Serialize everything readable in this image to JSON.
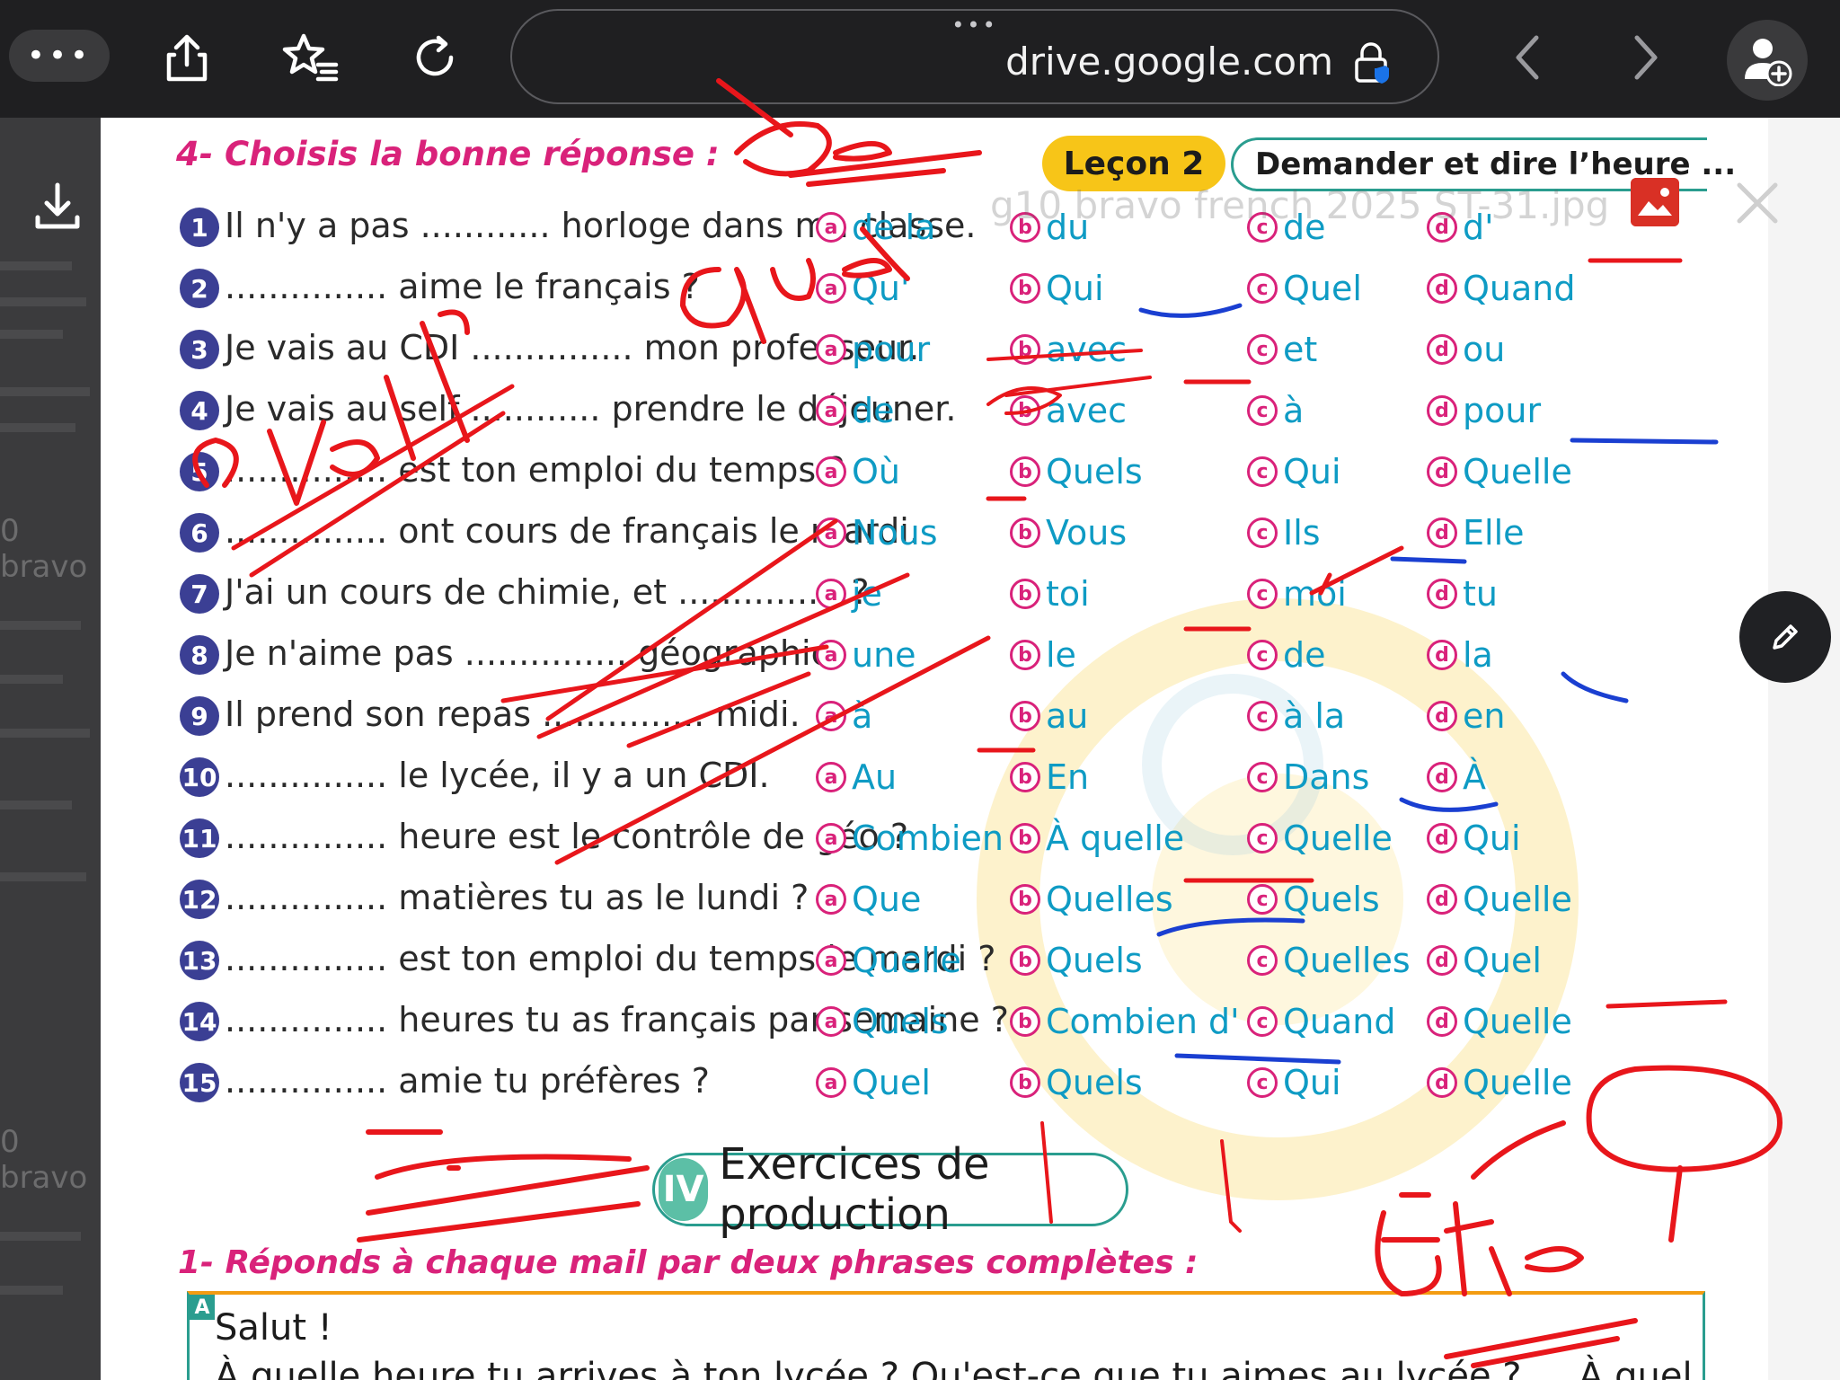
{
  "browser": {
    "address": "drive.google.com",
    "grip": "•••",
    "more_label": "•••",
    "icons": {
      "share": "share-icon",
      "bookmarks": "bookmarks-icon",
      "reload": "reload-icon",
      "lock": "lock-icon",
      "back": "chevron-left-icon",
      "forward": "chevron-right-icon",
      "profile": "add-person-icon"
    }
  },
  "viewer": {
    "filename": "g10 bravo french 2025 ST-31.jpg",
    "background_peek": [
      "0 bravo",
      "0 bravo"
    ],
    "icons": {
      "download": "download-icon",
      "close": "close-icon",
      "edit": "pencil-icon",
      "file_type": "image-icon"
    }
  },
  "worksheet": {
    "section_title": "4- Choisis la bonne réponse :",
    "lesson_badge": "Leçon 2",
    "lesson_topic": "Demander et dire l’heure ...",
    "questions": [
      {
        "num": "1",
        "text": "Il n'y a pas ............ horloge dans ma classe.",
        "options": [
          "de la",
          "du",
          "de",
          "d'"
        ]
      },
      {
        "num": "2",
        "text": "............... aime le français ?",
        "options": [
          "Qu'",
          "Qui",
          "Quel",
          "Quand"
        ]
      },
      {
        "num": "3",
        "text": "Je vais au CDI ............... mon professeur.",
        "options": [
          "pour",
          "avec",
          "et",
          "ou"
        ]
      },
      {
        "num": "4",
        "text": "Je vais au self ............ prendre le déjeuner.",
        "options": [
          "de",
          "avec",
          "à",
          "pour"
        ]
      },
      {
        "num": "5",
        "text": "............... est ton emploi du temps ?",
        "options": [
          "Où",
          "Quels",
          "Qui",
          "Quelle"
        ]
      },
      {
        "num": "6",
        "text": "............... ont cours de français le mardi.",
        "options": [
          "Nous",
          "Vous",
          "Ils",
          "Elle"
        ]
      },
      {
        "num": "7",
        "text": "J'ai un cours de chimie, et ............... ?",
        "options": [
          "je",
          "toi",
          "moi",
          "tu"
        ]
      },
      {
        "num": "8",
        "text": "Je n'aime pas ............... géographie.",
        "options": [
          "une",
          "le",
          "de",
          "la"
        ]
      },
      {
        "num": "9",
        "text": "Il prend son repas ............... midi.",
        "options": [
          "à",
          "au",
          "à la",
          "en"
        ]
      },
      {
        "num": "10",
        "text": "............... le lycée, il y a un CDI.",
        "options": [
          "Au",
          "En",
          "Dans",
          "À"
        ]
      },
      {
        "num": "11",
        "text": "............... heure est le contrôle de géo ?",
        "options": [
          "Combien",
          "À quelle",
          "Quelle",
          "Qui"
        ]
      },
      {
        "num": "12",
        "text": "............... matières tu as le lundi ?",
        "options": [
          "Que",
          "Quelles",
          "Quels",
          "Quelle"
        ]
      },
      {
        "num": "13",
        "text": "............... est ton emploi du temps le mardi ?",
        "options": [
          "Quelle",
          "Quels",
          "Quelles",
          "Quel"
        ]
      },
      {
        "num": "14",
        "text": "............... heures tu as français par semaine ?",
        "options": [
          "Quels",
          "Combien d'",
          "Quand",
          "Quelle"
        ]
      },
      {
        "num": "15",
        "text": "............... amie tu préfères ?",
        "options": [
          "Quel",
          "Quels",
          "Qui",
          "Quelle"
        ]
      }
    ],
    "option_letters": [
      "a",
      "b",
      "c",
      "d"
    ],
    "production_num": "IV",
    "production_title": "Exercices de production",
    "subsection_title": "1- Réponds à chaque mail par deux phrases complètes :",
    "mail_letter": "A",
    "mail_greeting": "Salut !",
    "mail_first_line": "À quelle heure tu arrives à ton lycée ? Qu'est-ce que tu aimes au lycée ? ... À quel"
  },
  "handwriting": {
    "words": [
      "de",
      "Que",
      "avoir",
      "être"
    ]
  },
  "colors": {
    "toolbar": "#1f1f21",
    "accent_pink": "#d9227a",
    "option_blue": "#0e9bc4",
    "number_navy": "#3b3f94",
    "teal": "#2a9d8f",
    "badge_yellow": "#f7c518",
    "ink_red": "#e8161b",
    "ink_blue": "#1a3fd1"
  }
}
